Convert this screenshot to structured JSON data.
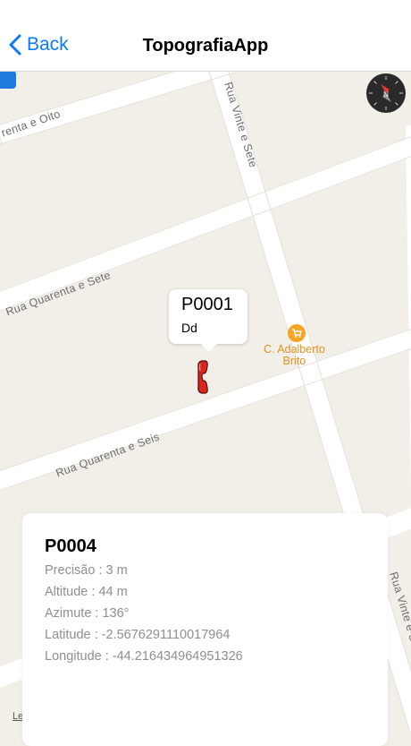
{
  "navbar": {
    "back_label": "Back",
    "title": "TopografiaApp"
  },
  "map": {
    "streets": {
      "rua_quarenta_e_oito": "renta e Oito",
      "rua_vinte_e_sete_top": "Rua Vinte e Sete",
      "rua_quarenta_e_sete": "Rua Quarenta e Sete",
      "rua_quarenta_e_seis": "Rua Quarenta e Seis",
      "rua_vinte_e_sete_bottom": "Rua Vinte e Sete"
    },
    "poi_label_line1": "C. Adalberto",
    "poi_label_line2": "Brito",
    "legal_label": "Le",
    "colors": {
      "land": "#f2efe9",
      "street": "#ffffff",
      "poi": "#f6a623",
      "accent": "#0a7aff"
    }
  },
  "callout": {
    "title": "P0001",
    "subtitle": "Dd"
  },
  "card": {
    "name": "P0004",
    "rows": [
      "Precisão  : 3 m",
      "Altitude  : 44 m",
      "Azimute  : 136°",
      "Latitude  : -2.5676291110017964",
      "Longitude  : -44.216434964951326"
    ]
  },
  "icons": {
    "back": "chevron-left-icon",
    "compass": "compass-icon",
    "marker": "phone-icon",
    "poi": "shopping-cart-icon"
  }
}
